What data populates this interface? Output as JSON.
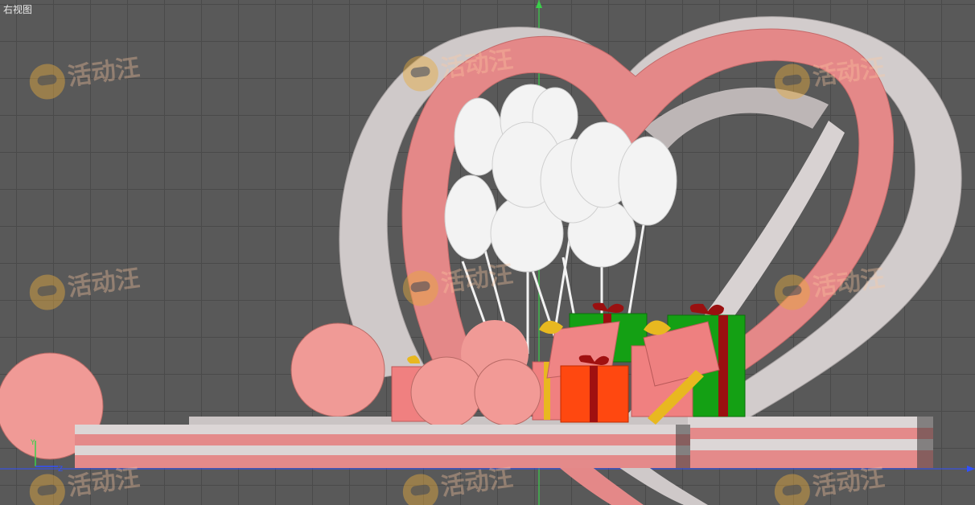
{
  "viewport": {
    "label": "右视图",
    "watermark_text": "活动汪"
  },
  "scene": {
    "objects": [
      "heart-ribbon-white",
      "heart-ribbon-pink",
      "balloon-cluster",
      "gift-boxes",
      "pink-spheres",
      "stage-platform"
    ],
    "colors": {
      "ribbon_white": "#d6d0d0",
      "ribbon_pink": "#e58a8a",
      "balloon": "#f4f4f4",
      "sphere": "#f29a96",
      "gift_green": "#1a9a1a",
      "gift_red": "#ff4a12",
      "gift_pink": "#f08080",
      "bow_gold": "#e8b820",
      "bow_darkred": "#9a1010"
    }
  },
  "axes": {
    "y_color": "#3ad04a",
    "x_color": "#3050ff"
  }
}
